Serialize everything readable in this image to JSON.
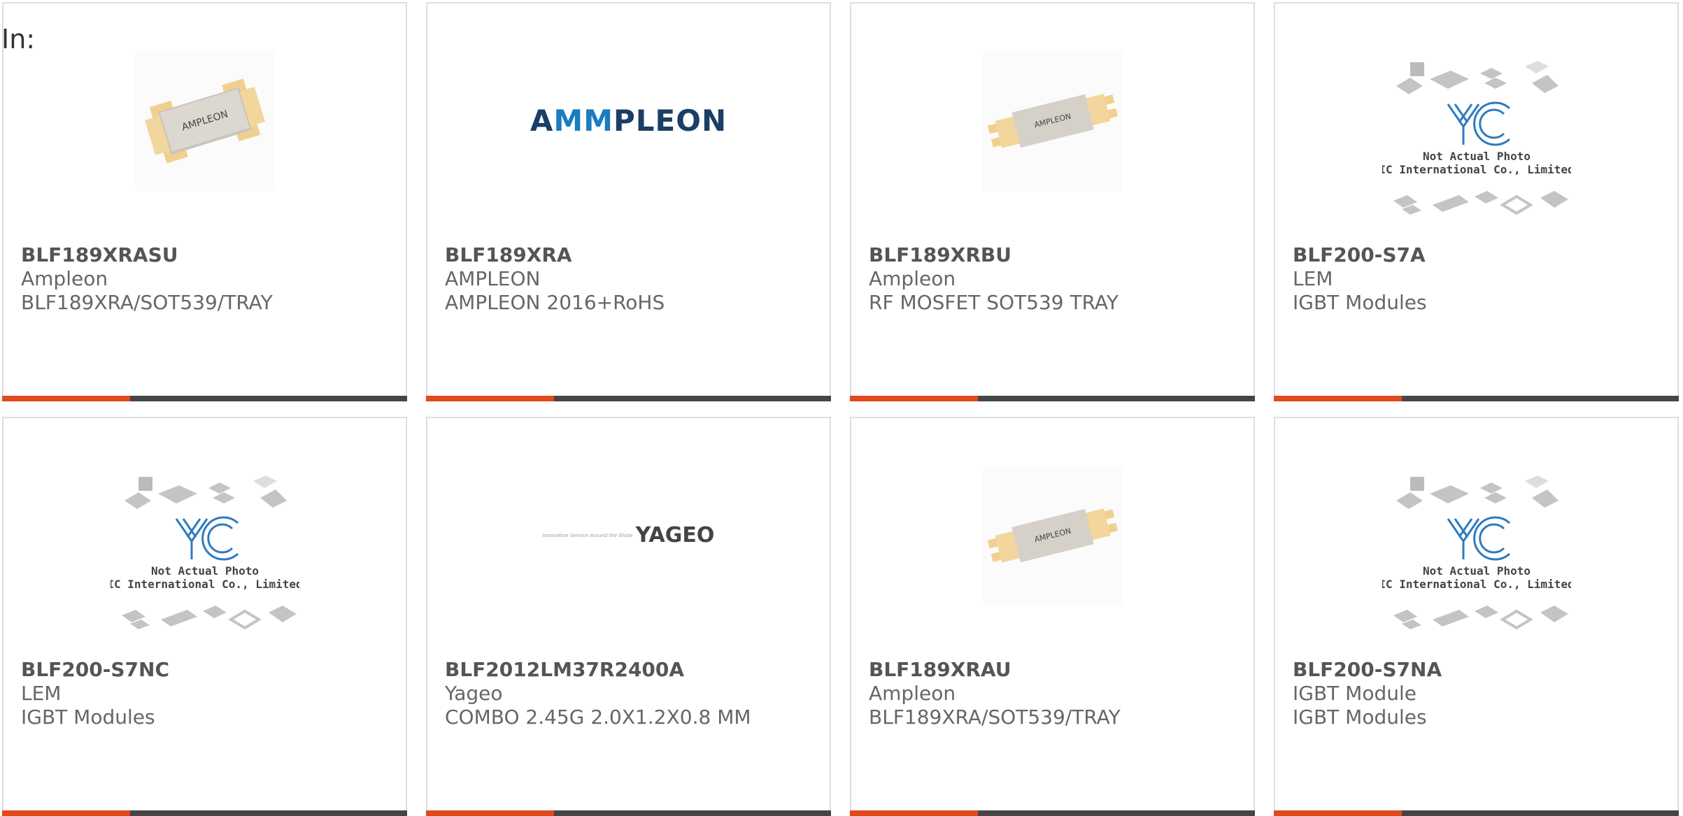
{
  "prefix": "In:",
  "colors": {
    "accent": "#e2481a",
    "bar": "#454545",
    "border": "#dedede",
    "text": "#666666"
  },
  "products": [
    {
      "part": "BLF189XRASU",
      "brand": "Ampleon",
      "desc": "BLF189XRA/SOT539/TRAY",
      "image": "chip-photo-large"
    },
    {
      "part": "BLF189XRA",
      "brand": "AMPLEON",
      "desc": "AMPLEON 2016+RoHS",
      "image": "ampleon-logo",
      "logo_a": "A",
      "logo_mm": "MM",
      "logo_rest": "PLEON"
    },
    {
      "part": "BLF189XRBU",
      "brand": "Ampleon",
      "desc": "RF MOSFET SOT539 TRAY",
      "image": "chip-photo"
    },
    {
      "part": "BLF200-S7A",
      "brand": "LEM",
      "desc": "IGBT Modules",
      "image": "yic-placeholder",
      "note1": "Not Actual Photo",
      "note2": "YIC International Co., Limited."
    },
    {
      "part": "BLF200-S7NC",
      "brand": "LEM",
      "desc": "IGBT Modules",
      "image": "yic-placeholder",
      "note1": "Not Actual Photo",
      "note2": "YIC International Co., Limited."
    },
    {
      "part": "BLF2012LM37R2400A",
      "brand": "Yageo",
      "desc": "COMBO 2.45G 2.0X1.2X0.8 MM",
      "image": "yageo-logo",
      "logo_tag": "Innovation Service Around the Globe",
      "logo_word": "YAGEO"
    },
    {
      "part": "BLF189XRAU",
      "brand": "Ampleon",
      "desc": "BLF189XRA/SOT539/TRAY",
      "image": "chip-photo"
    },
    {
      "part": "BLF200-S7NA",
      "brand": "IGBT Module",
      "desc": "IGBT Modules",
      "image": "yic-placeholder",
      "note1": "Not Actual Photo",
      "note2": "YIC International Co., Limited."
    }
  ],
  "chip_label": "AMPLEON"
}
